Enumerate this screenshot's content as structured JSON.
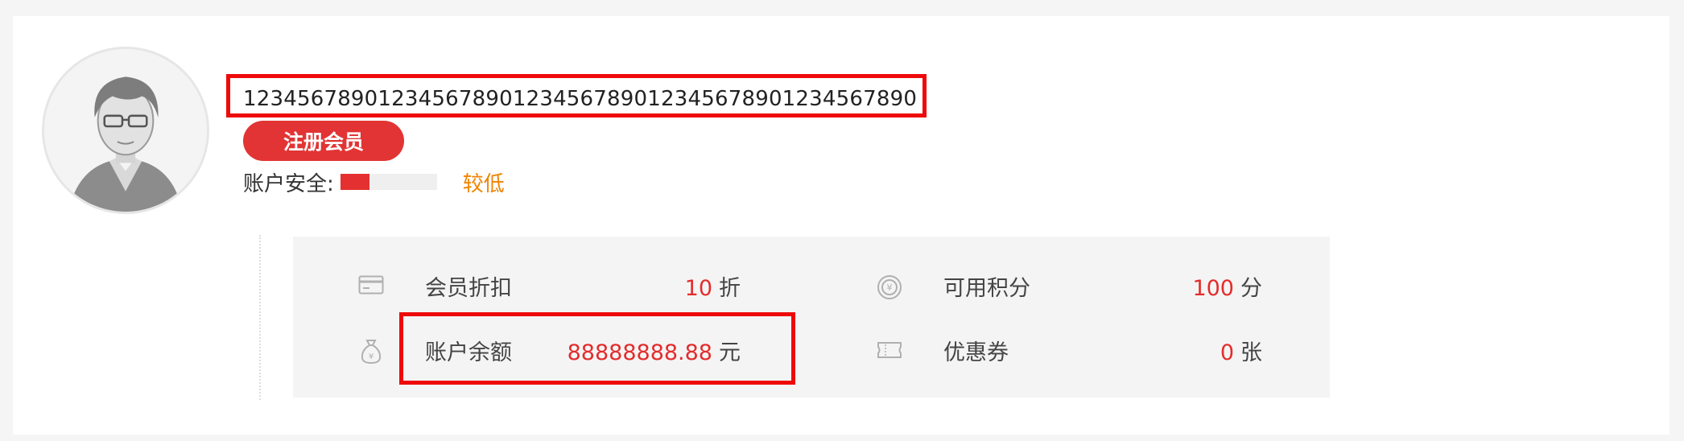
{
  "user": {
    "username": "12345678901234567890123456789012345678901234567890",
    "member_button": "注册会员",
    "security_label": "账户安全:",
    "security_level": "较低",
    "security_fraction": 0.3
  },
  "stats": {
    "discount": {
      "label": "会员折扣",
      "value": "10",
      "unit": "折",
      "icon": "card-icon"
    },
    "points": {
      "label": "可用积分",
      "value": "100",
      "unit": "分",
      "icon": "coin-icon"
    },
    "balance": {
      "label": "账户余额",
      "value": "88888888.88",
      "unit": "元",
      "icon": "money-bag-icon"
    },
    "coupons": {
      "label": "优惠券",
      "value": "0",
      "unit": "张",
      "icon": "ticket-icon"
    }
  },
  "colors": {
    "accent_red": "#e23434",
    "highlight_red": "#ee0a0a",
    "warning_orange": "#f08300",
    "value_red": "#e32c2c"
  }
}
